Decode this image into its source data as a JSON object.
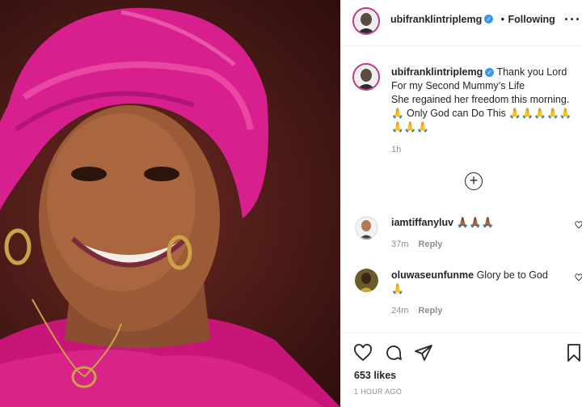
{
  "post": {
    "username": "ubifranklintriplemg",
    "verified_icon": "verified-badge-icon",
    "follow_label": "Following",
    "follow_separator": "•",
    "more_label": "···",
    "caption_lines": [
      "Thank you Lord",
      "For my Second Mummy’s Life",
      "She regained her freedom this morning.",
      "🙏 Only God can Do This 🙏🙏🙏🙏🙏",
      "🙏🙏🙏"
    ],
    "caption_time": "1h",
    "load_more_icon": "plus-circle-icon",
    "comments": [
      {
        "username": "iamtiffanyluv",
        "text": "🙏🏾🙏🏾🙏🏾",
        "time": "37m",
        "reply": "Reply"
      },
      {
        "username": "oluwaseunfunme",
        "text": "Glory be to God",
        "text2": "🙏",
        "time": "24m",
        "reply": "Reply"
      }
    ],
    "likes": "653 likes",
    "posted": "1 HOUR AGO"
  },
  "colors": {
    "accent_ring": "#c13584",
    "verified": "#3897f0",
    "text": "#262626",
    "muted": "#8e8e8e",
    "gele": "#d81f8e"
  }
}
